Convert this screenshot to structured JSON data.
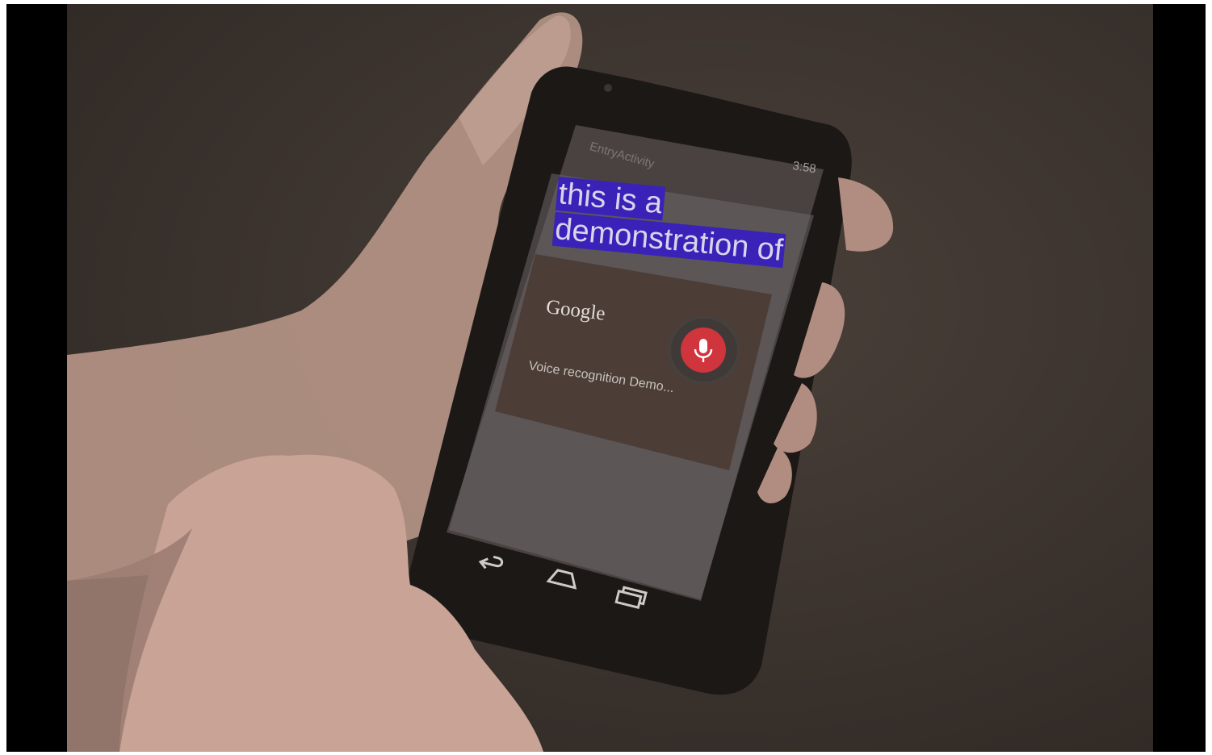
{
  "app": {
    "activity_title": "EntryActivity",
    "clock": "3:58"
  },
  "speech_result": {
    "line1": "this is a",
    "line2": "demonstration of"
  },
  "voice_dialog": {
    "brand": "Google",
    "prompt": "Voice recognition Demo...",
    "mic_icon": "microphone-icon"
  },
  "nav_bar": {
    "icons": [
      "back-icon",
      "home-icon",
      "recent-apps-icon"
    ]
  },
  "colors": {
    "highlight": "#3a22b8",
    "mic_accent": "#d0343c"
  }
}
